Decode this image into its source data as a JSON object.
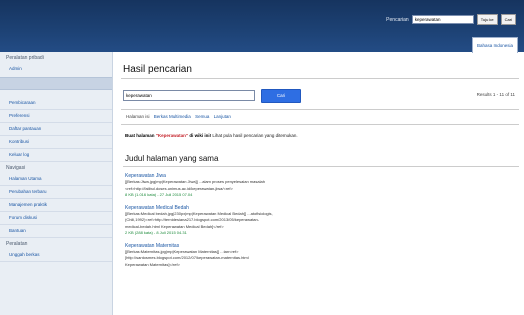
{
  "header": {
    "search_label": "Pencarian",
    "search_value": "keperawatan",
    "go_button": "Tuju ke",
    "search_button": "Cari",
    "language_tab": "Bahasa Indonesia"
  },
  "sidebar": {
    "personal_tools_title": "Peralatan pribadi",
    "personal_items": [
      "Admin"
    ],
    "box_label": "",
    "main_items": [
      "Pembicaraan",
      "Preferensi",
      "Daftar pantauan",
      "Kontribusi",
      "Keluar log"
    ],
    "navigation_title": "Navigasi",
    "navigation_items": [
      "Halaman Utama",
      "Perubahan terbaru",
      "Manajemen praktik",
      "Forum diskusi",
      "Bantuan"
    ],
    "tools_title": "Peralatan",
    "tools_items": [
      "Unggah berkas"
    ]
  },
  "main": {
    "title": "Hasil pencarian",
    "query_value": "keperawatan",
    "search_button": "Cari",
    "results_count": "Results 1 - 11 of 11",
    "filters_label": "Halaman isi",
    "filters": [
      "Berkas Multimedia",
      "Semua",
      "Lanjutan"
    ],
    "create_prefix": "Buat halaman",
    "create_term": "\"Keperawatan\"",
    "create_suffix": "di wiki ini!",
    "create_hint": "Lihat pula hasil pencarian yang ditemukan.",
    "section_title": "Judul halaman yang sama",
    "results": [
      {
        "title": "Keperawatan Jiwa",
        "line1": "[[Berkas:Jiwa.jpg|mp|Keperawatan Jiwa]] ...alam proses penyelesaian masalah",
        "line2": "<ref>http://faiibul.doses.unimus.ac.id/keperawatan-jiwa/<ref>",
        "meta": "8 KB (1.016 kata) - 27 Juli 2015 07.04"
      },
      {
        "title": "Keperawatan Medical Bedah",
        "line1": "[[Berkas:Medical bedah.jpg|230px|mp|Keperawatan Medical Bedah]] ...atofisiologis,",
        "line2": "(Chili,1992)<ref>http://ternidesiana217.blogspot.com/2013/05/keperawatan-",
        "line3": "medical-bedah.html Keperawatan Medical Bedah]</ref>",
        "meta": "2 KB (288 kata) - 8 Juli 2015 04.31"
      },
      {
        "title": "Keperawatan Maternitas",
        "line1": "[[Berkas:Maternitas.jpg|mp|Keperawatan Maternitas]] ...tan<ref>",
        "line2": "[http://santosmes.blogspot.com/2012/07/keperawatan-maternitas.html",
        "line3": "Keperawatan Maternitas]</ref>"
      }
    ]
  }
}
